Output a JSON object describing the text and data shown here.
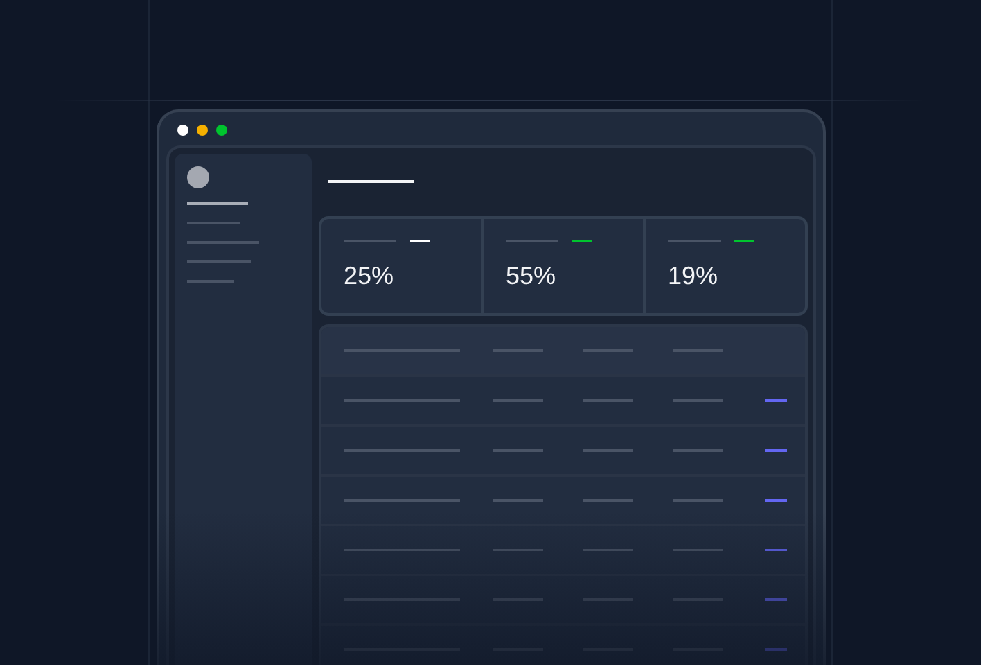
{
  "window": {
    "controls": [
      {
        "color": "#ffffff"
      },
      {
        "color": "#f5b000"
      },
      {
        "color": "#00c42e"
      }
    ]
  },
  "stats": [
    {
      "value": "25%",
      "color": "#ffffff"
    },
    {
      "value": "55%",
      "color": "#00c42e"
    },
    {
      "value": "19%",
      "color": "#00c42e"
    }
  ]
}
